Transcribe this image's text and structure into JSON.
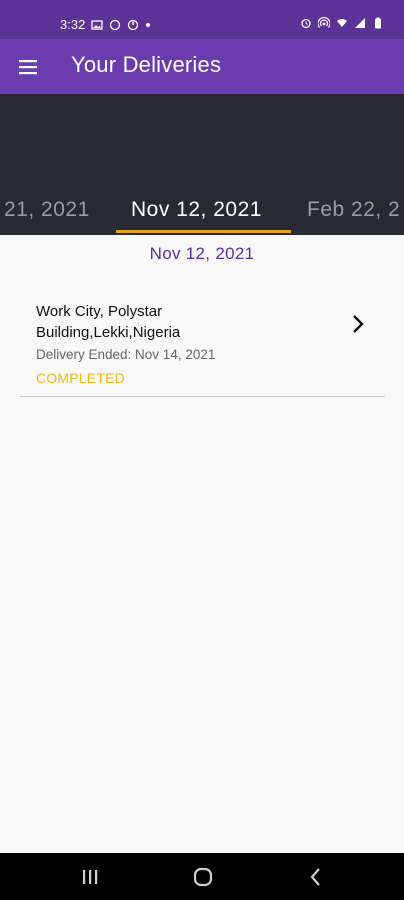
{
  "status_bar": {
    "time": "3:32",
    "left_icons": [
      "image-icon",
      "circle-outline-icon",
      "timer-icon",
      "dot-icon"
    ],
    "right_icons": [
      "alarm-icon",
      "hotspot-icon",
      "wifi-icon",
      "signal-icon",
      "battery-icon"
    ]
  },
  "app_bar": {
    "title": "Your Deliveries",
    "menu_icon": "hamburger-menu-icon",
    "background": "#6a3cad"
  },
  "date_tabs": {
    "items": [
      "21, 2021",
      "Nov 12, 2021",
      "Feb 22, 2"
    ],
    "selected_index": 1,
    "indicator_color": "#e0a31a"
  },
  "section": {
    "date": "Nov 12, 2021"
  },
  "deliveries": [
    {
      "address": "Work City, Polystar Building,Lekki,Nigeria",
      "ended": "Delivery Ended: Nov 14, 2021",
      "status": "COMPLETED",
      "status_color": "#f1b814"
    }
  ],
  "nav_bar": {
    "buttons": [
      "recents-icon",
      "home-icon",
      "back-icon"
    ]
  }
}
